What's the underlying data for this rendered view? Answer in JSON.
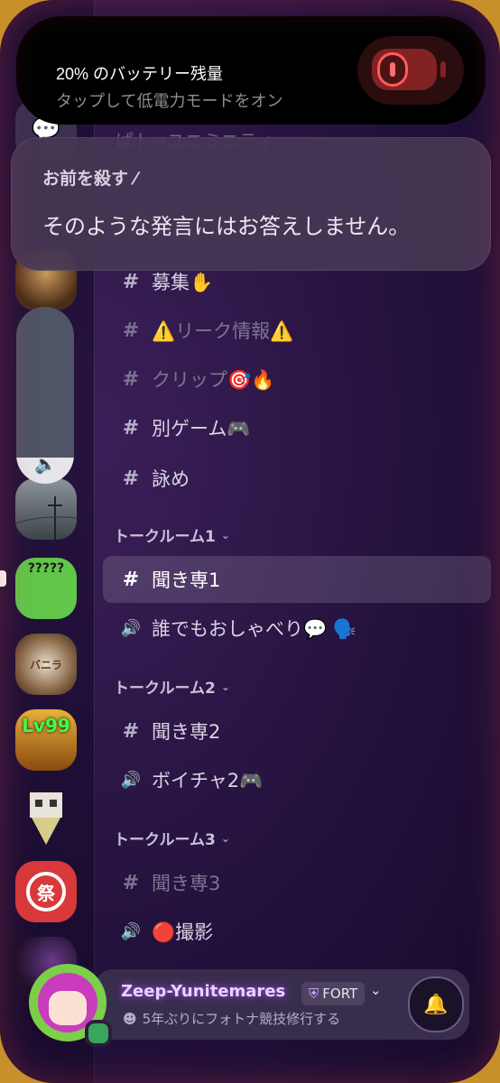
{
  "island": {
    "battery_title": "20% のバッテリー残量",
    "battery_subtitle": "タップして低電力モードをオン"
  },
  "notification": {
    "title": "お前を殺す ⁄",
    "body": "そのような発言にはお答えしません。"
  },
  "volume": {
    "level": 0.15
  },
  "hidden_channel_fragment": "ぱト→ユニミニティ",
  "channels": [
    {
      "icon": "#",
      "label": "募集✋",
      "muted": false
    },
    {
      "icon": "#",
      "label": "⚠️リーク情報⚠️",
      "muted": true
    },
    {
      "icon": "#",
      "label": "クリップ🎯🔥",
      "muted": true
    },
    {
      "icon": "#",
      "label": "別ゲーム🎮",
      "muted": false
    },
    {
      "icon": "#",
      "label": "詠め",
      "muted": false
    }
  ],
  "categories": [
    {
      "name": "トークルーム1",
      "chevron": "⌄",
      "channels": [
        {
          "icon": "#",
          "label": "聞き専1",
          "active": true
        },
        {
          "icon": "🔊",
          "label": "誰でもおしゃべり💬 🗣️",
          "active": false
        }
      ]
    },
    {
      "name": "トークルーム2",
      "chevron": "⌄",
      "channels": [
        {
          "icon": "#",
          "label": "聞き専2",
          "active": false
        },
        {
          "icon": "🔊",
          "label": "ボイチャ2🎮",
          "active": false
        }
      ]
    },
    {
      "name": "トークルーム3",
      "chevron": "⌄",
      "channels": [
        {
          "icon": "#",
          "label": "聞き専3",
          "active": false,
          "muted": true
        },
        {
          "icon": "🔊",
          "label": "🔴撮影",
          "active": false
        }
      ]
    }
  ],
  "servers": [
    {
      "label": "?????",
      "color": "#62c64a"
    },
    {
      "label": "バニラ",
      "color": "#8a6a4a"
    },
    {
      "label": "Lv99",
      "color": "#c8861a"
    },
    {
      "label": "",
      "color": "#2a2038"
    },
    {
      "label": "祭",
      "color": "#d9393a"
    },
    {
      "label": "",
      "color": "#2b1b3d"
    }
  ],
  "user": {
    "name": "Zeep-Yunitemares",
    "tag": "FORT",
    "tag_icon": "shield-icon",
    "status": "5年ぶりにフォトナ競技修行する",
    "online_color": "#3ba55c"
  },
  "colors": {
    "accent": "#b04cff",
    "active_row": "#ffffff",
    "battery_red": "#ff5b5b"
  }
}
